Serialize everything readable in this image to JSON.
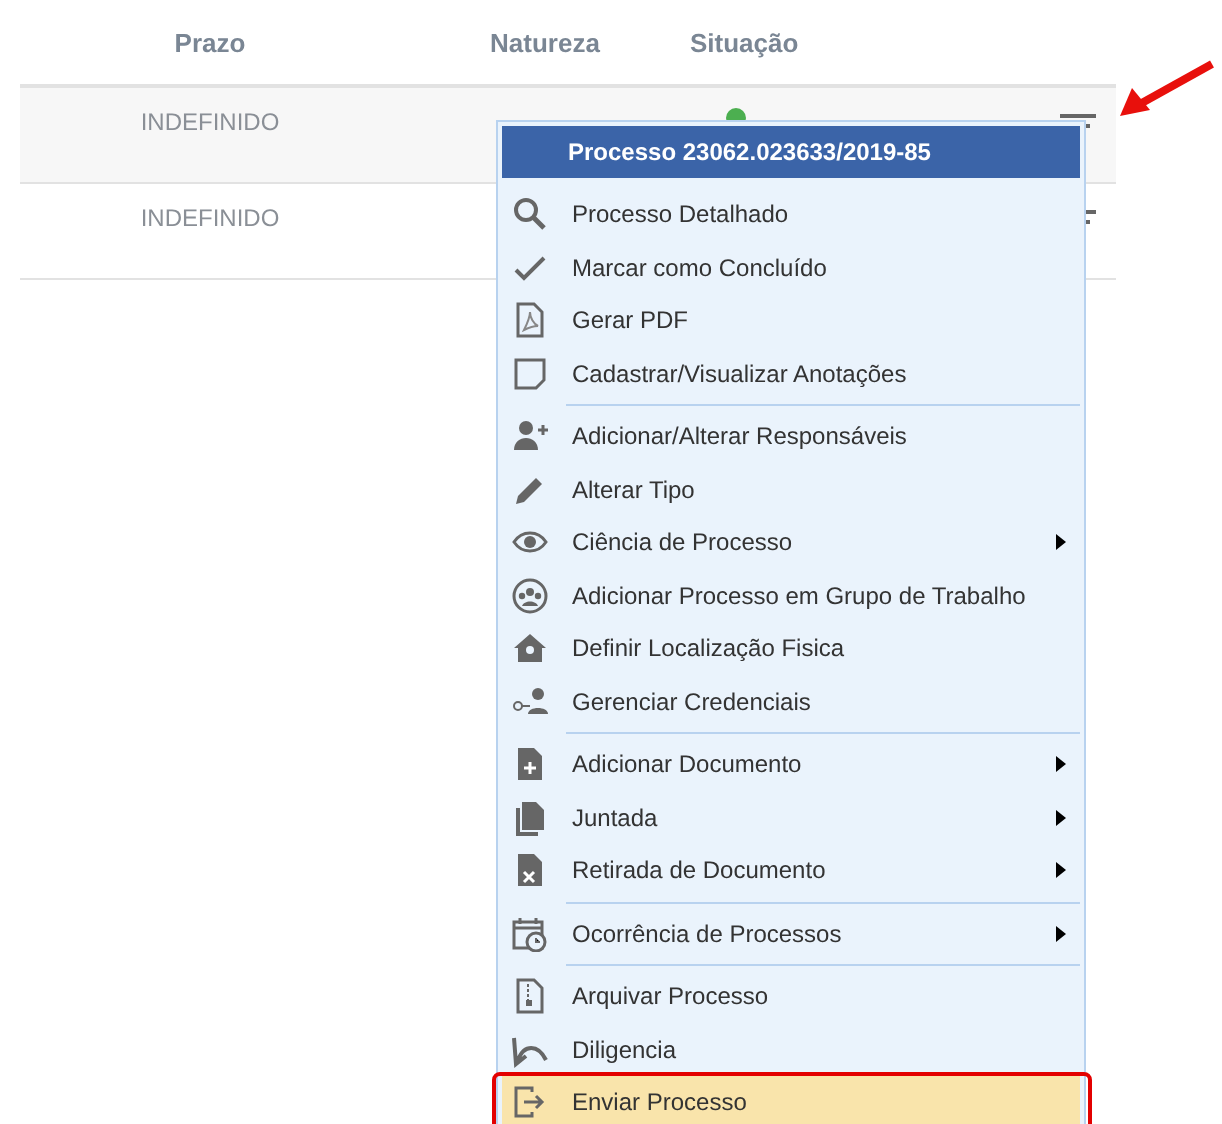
{
  "table": {
    "columns": [
      "Prazo",
      "Natureza",
      "Situação"
    ],
    "rows": [
      {
        "prazo": "INDEFINIDO",
        "color": "#4caf50",
        "selected": true
      },
      {
        "prazo": "INDEFINIDO",
        "selected": false
      }
    ]
  },
  "context_menu": {
    "title": "Processo 23062.023633/2019-85",
    "groups": [
      {
        "items": [
          {
            "label": "Processo Detalhado",
            "submenu": false,
            "selected": false
          },
          {
            "label": "Marcar como Concluído",
            "submenu": false,
            "selected": false
          },
          {
            "label": "Gerar PDF",
            "submenu": false,
            "selected": false
          },
          {
            "label": "Cadastrar/Visualizar Anotações",
            "submenu": false,
            "selected": false
          }
        ]
      },
      {
        "items": [
          {
            "label": "Adicionar/Alterar Responsáveis",
            "submenu": false,
            "selected": false
          },
          {
            "label": "Alterar Tipo",
            "submenu": false,
            "selected": false
          },
          {
            "label": "Ciência de Processo",
            "submenu": true,
            "selected": false
          },
          {
            "label": "Adicionar Processo em Grupo de Trabalho",
            "submenu": false,
            "selected": false
          },
          {
            "label": "Definir Localização Fisica",
            "submenu": false,
            "selected": false
          },
          {
            "label": "Gerenciar Credenciais",
            "submenu": false,
            "selected": false
          }
        ]
      },
      {
        "items": [
          {
            "label": "Adicionar Documento",
            "submenu": true,
            "selected": false
          },
          {
            "label": "Juntada",
            "submenu": true,
            "selected": false
          },
          {
            "label": "Retirada de Documento",
            "submenu": true,
            "selected": false
          }
        ]
      },
      {
        "items": [
          {
            "label": "Ocorrência de Processos",
            "submenu": true,
            "selected": false
          }
        ]
      },
      {
        "items": [
          {
            "label": "Arquivar Processo",
            "submenu": false,
            "selected": false
          },
          {
            "label": "Diligencia",
            "submenu": false,
            "selected": false
          },
          {
            "label": "Enviar Processo",
            "submenu": false,
            "selected": true
          }
        ]
      }
    ]
  }
}
